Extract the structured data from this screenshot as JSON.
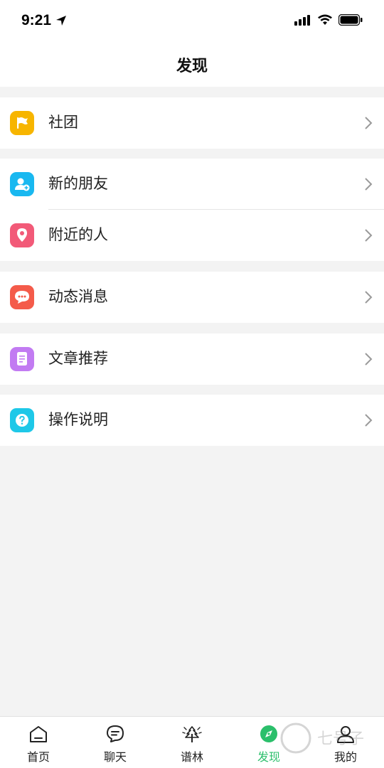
{
  "status_bar": {
    "time": "9:21"
  },
  "header": {
    "title": "发现"
  },
  "menu": {
    "club": {
      "label": "社团",
      "color": "#f7b500",
      "icon": "flag-icon"
    },
    "new_friends": {
      "label": "新的朋友",
      "color": "#19b8f0",
      "icon": "add-friend-icon"
    },
    "nearby": {
      "label": "附近的人",
      "color": "#f25a78",
      "icon": "location-pin-icon"
    },
    "moments": {
      "label": "动态消息",
      "color": "#f45b4a",
      "icon": "chat-bubble-icon"
    },
    "articles": {
      "label": "文章推荐",
      "color": "#c27bf2",
      "icon": "document-icon"
    },
    "guide": {
      "label": "操作说明",
      "color": "#1ec8e8",
      "icon": "question-icon"
    }
  },
  "tab_bar": {
    "tabs": [
      {
        "label": "首页",
        "icon": "home-icon"
      },
      {
        "label": "聊天",
        "icon": "chat-icon"
      },
      {
        "label": "谱林",
        "icon": "tree-icon"
      },
      {
        "label": "发现",
        "icon": "compass-icon",
        "active": true
      },
      {
        "label": "我的",
        "icon": "profile-icon"
      }
    ],
    "active_color": "#2bbf6b"
  },
  "watermark": {
    "text": "七号子"
  }
}
